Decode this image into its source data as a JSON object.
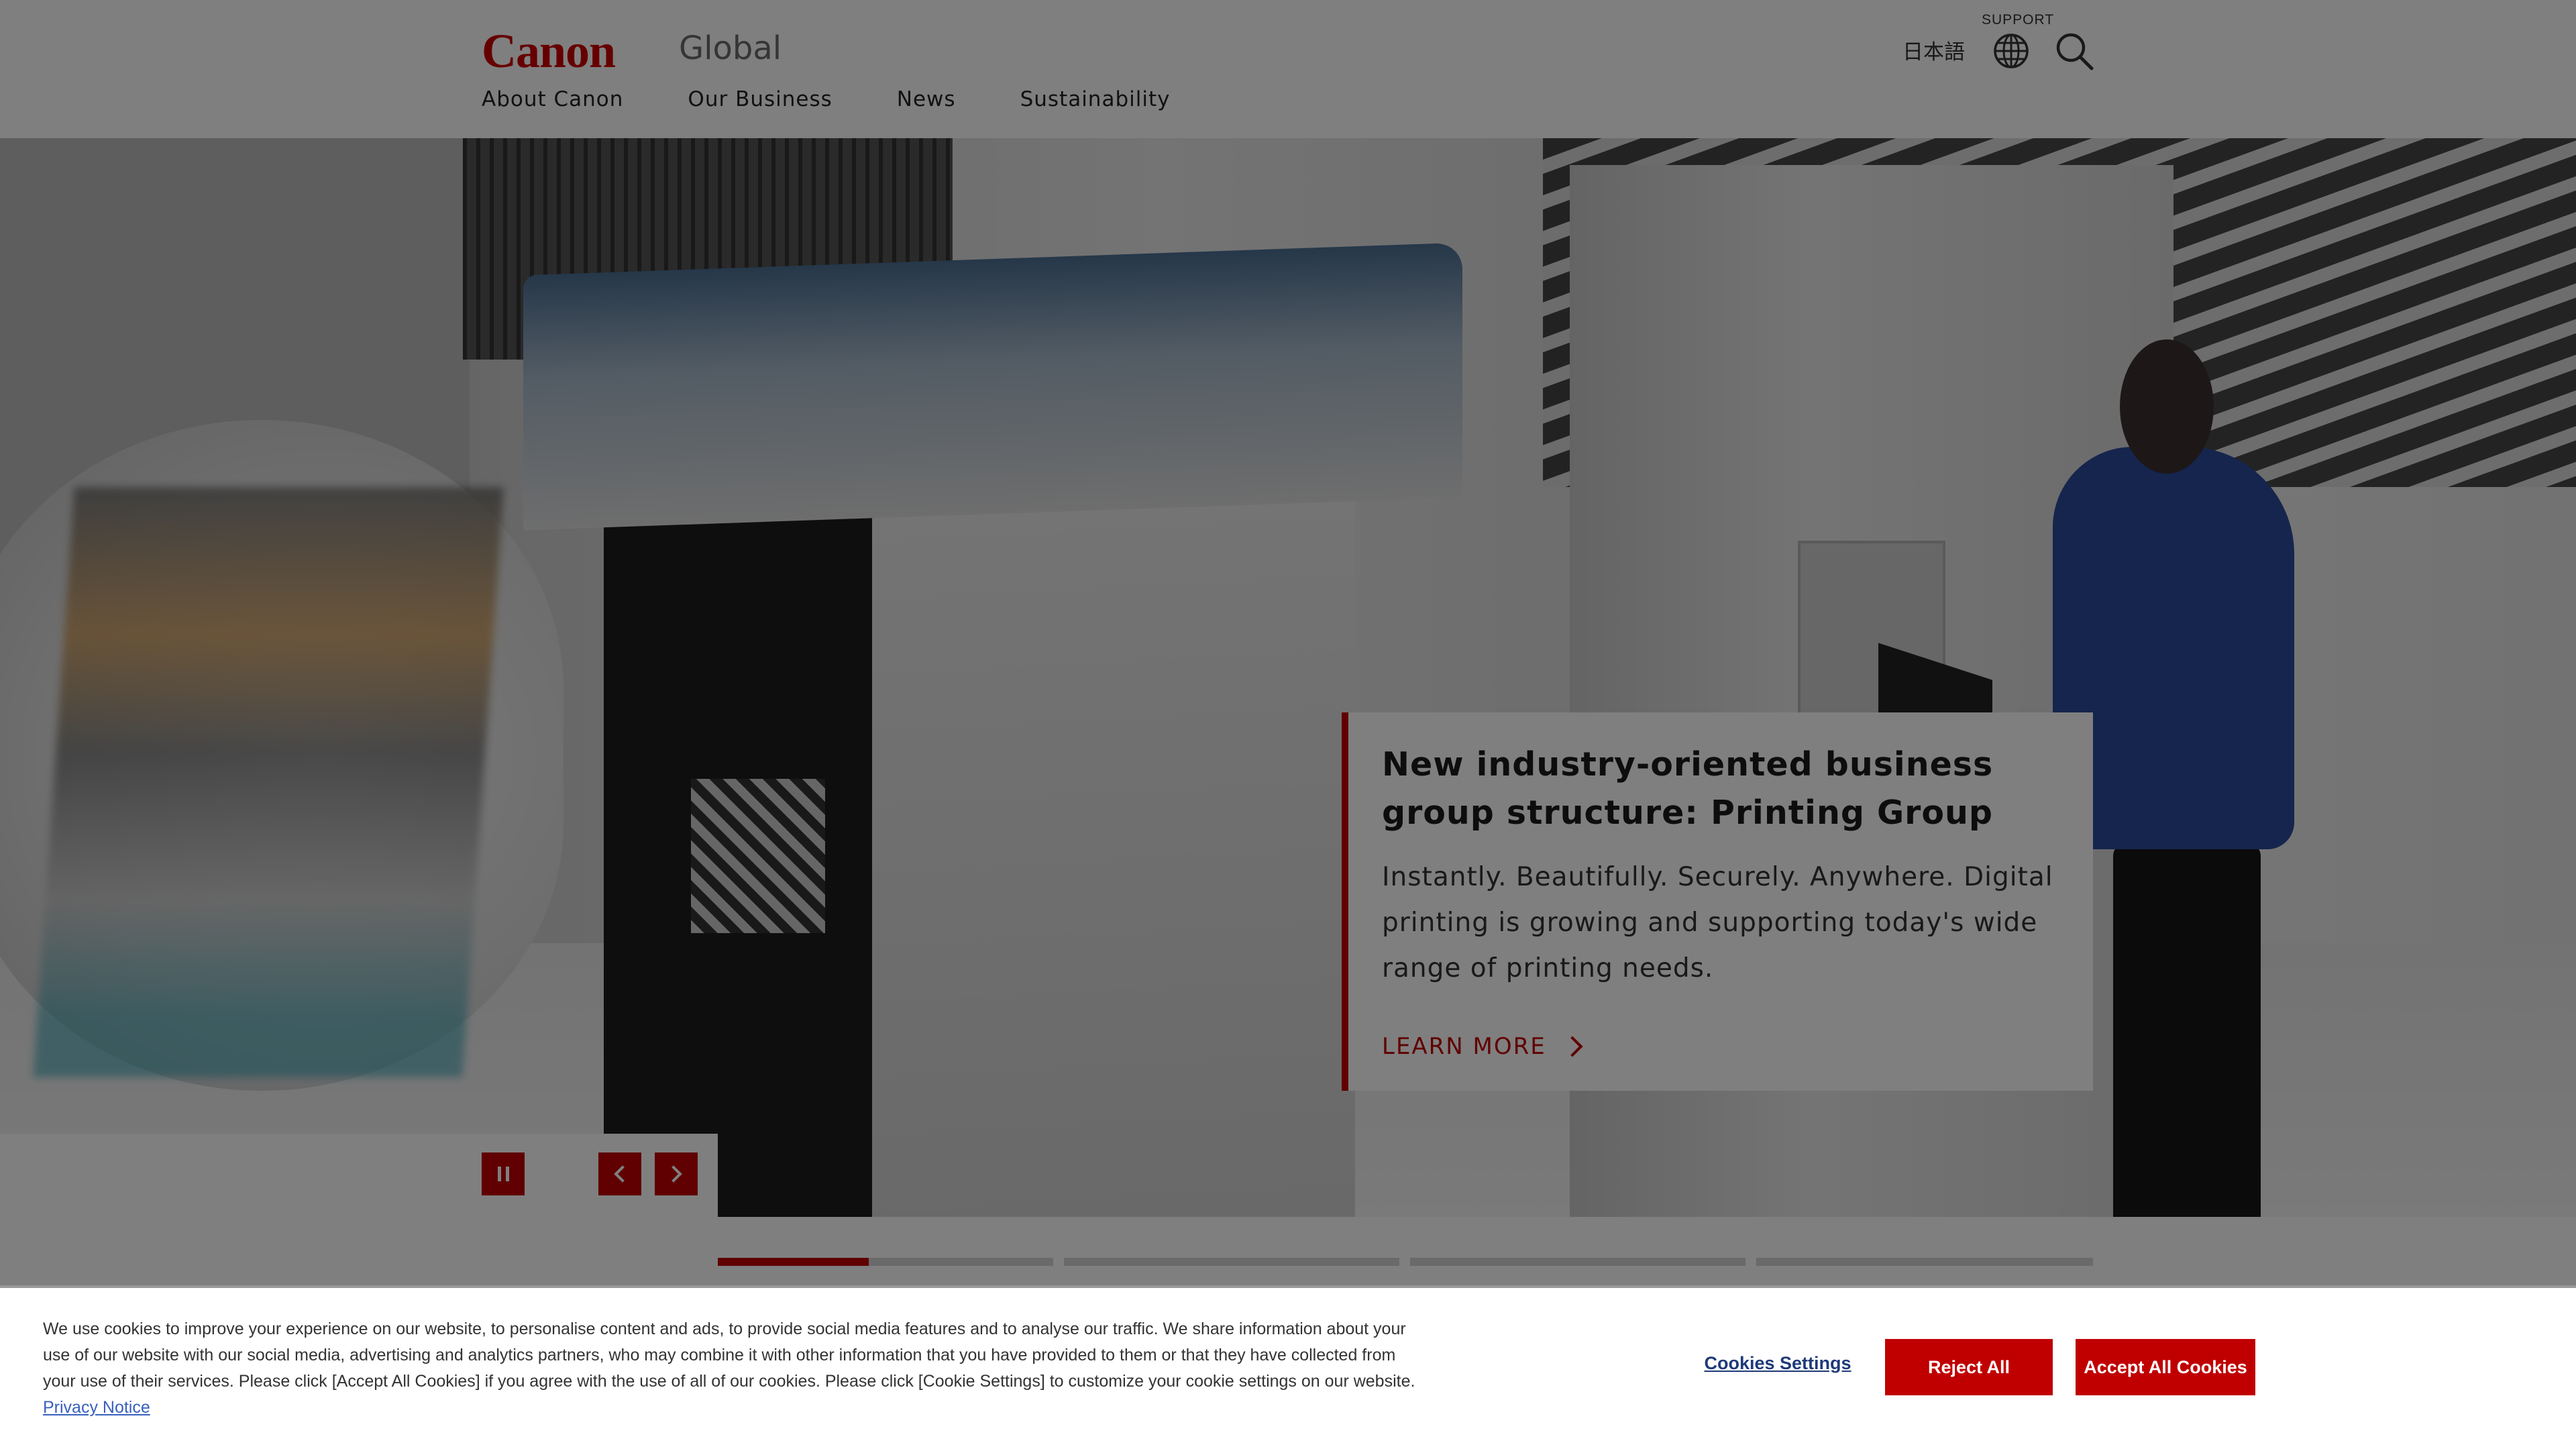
{
  "header": {
    "logo": "Canon",
    "site_label": "Global",
    "nav": [
      "About Canon",
      "Our Business",
      "News",
      "Sustainability"
    ],
    "language": "日本語",
    "support_label": "SUPPORT"
  },
  "hero": {
    "title": "New industry-oriented business group structure: Printing Group",
    "description": "Instantly. Beautifully. Securely. Anywhere. Digital printing is growing and supporting today's wide range of printing needs.",
    "link_label": "LEARN MORE"
  },
  "carousel": {
    "slide_count": 4,
    "current_slide": 1,
    "current_slide_progress": 0.45
  },
  "cookie_banner": {
    "text": "We use cookies to improve your experience on our website, to personalise content and ads, to provide social media features and to analyse our traffic. We share information about your use of our website with our social media, advertising and analytics partners, who may combine it with other information that you have provided to them or that they have collected from your use of their services. Please click [Accept All Cookies] if you agree with the use of all of our cookies. Please click [Cookie Settings] to customize your cookie settings on our website.",
    "privacy_link": "Privacy Notice",
    "settings_label": "Cookies Settings",
    "reject_label": "Reject All",
    "accept_label": "Accept All Cookies"
  },
  "colors": {
    "brand_red": "#c00000",
    "logo_red": "#cc0000",
    "link_blue": "#3860be"
  }
}
